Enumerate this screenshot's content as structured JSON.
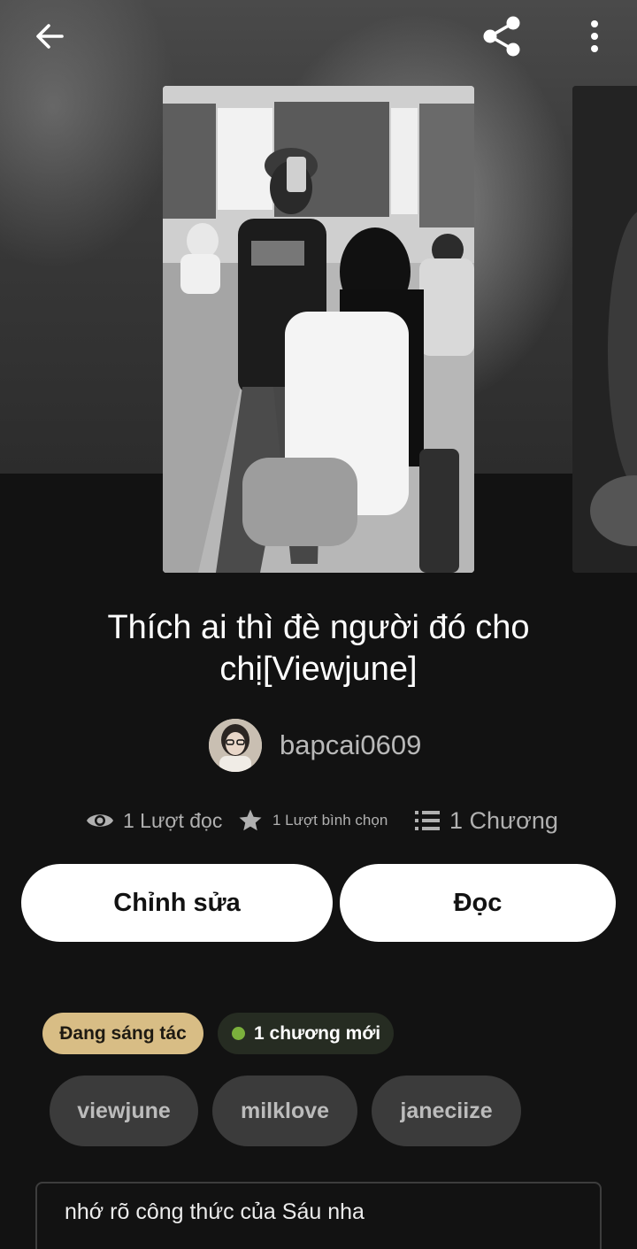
{
  "colors": {
    "background": "#121212",
    "primary_button_bg": "#ffffff",
    "status_badge_bg": "#d8bd85",
    "new_chapter_dot": "#7bb03c",
    "tag_bg": "#3b3b3b"
  },
  "topbar": {
    "back_icon": "arrow-left-icon",
    "share_icon": "share-icon",
    "more_icon": "more-vertical-icon"
  },
  "story": {
    "title": "Thích ai thì đè người đó cho chị[Viewjune]",
    "author": "bapcai0609"
  },
  "stats": {
    "reads": "1 Lượt đọc",
    "votes": "1 Lượt bình chọn",
    "parts": "1 Chương"
  },
  "actions": {
    "edit_label": "Chỉnh sửa",
    "read_label": "Đọc"
  },
  "badges": {
    "status": "Đang sáng tác",
    "new_chapters": "1 chương mới"
  },
  "tags": [
    "viewjune",
    "milklove",
    "janeciize"
  ],
  "description": "nhớ rõ công thức của Sáu nha"
}
